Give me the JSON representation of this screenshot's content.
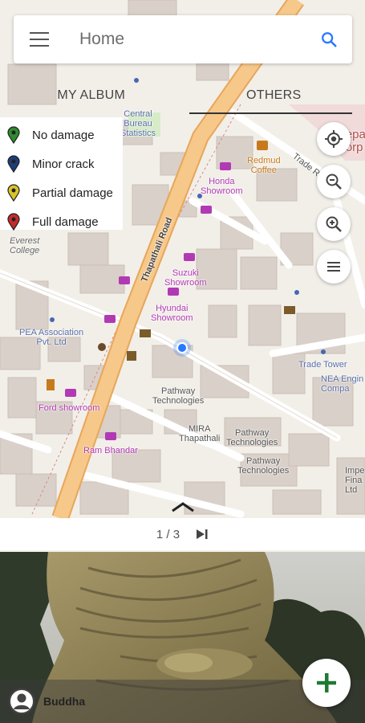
{
  "header": {
    "title": "Home",
    "search_icon": "search-icon",
    "menu_icon": "menu-icon"
  },
  "tabs": [
    {
      "label": "MY ALBUM",
      "active": false
    },
    {
      "label": "OTHERS",
      "active": true
    }
  ],
  "legend": [
    {
      "label": "No damage",
      "color": "#2e8b2e"
    },
    {
      "label": "Minor crack",
      "color": "#1f3c7a"
    },
    {
      "label": "Partial damage",
      "color": "#d8c42a"
    },
    {
      "label": "Full damage",
      "color": "#c62b2b"
    }
  ],
  "map": {
    "labels": {
      "central_bureau": "Central\nBureau\nStatistics",
      "redmud": "Redmud\nCoffee",
      "trade_road": "Trade Road",
      "honda": "Honda\nShowroom",
      "thapathali_road": "Thapathali Road",
      "everest": "Everest\nCollege",
      "suzuki": "Suzuki\nShowroom",
      "hyundai": "Hyundai\nShowroom",
      "pea": "PEA Association\nPvt. Ltd",
      "trade_tower": "Trade Tower",
      "nea": "NEA Engin\nCompa",
      "pathway1": "Pathway\nTechnologies",
      "mira": "MIRA\nThapathali",
      "pathway2": "Pathway\nTechnologies",
      "pathway3": "Pathway\nTechnologies",
      "ford": "Ford showroom",
      "ram": "Ram Bhandar",
      "impe": "Impe\nFina\nLtd",
      "nepa": "Nepa\nCorp"
    },
    "buttons": [
      "my-location-icon",
      "zoom-out-icon",
      "zoom-in-icon",
      "layers-menu-icon"
    ]
  },
  "pager": {
    "text": "1 / 3",
    "next_icon": "skip-to-last-icon"
  },
  "photo": {
    "caption": "Buddha",
    "avatar_icon": "user-avatar-icon"
  },
  "fab": {
    "icon": "add-icon",
    "color": "#1e7a32"
  },
  "colors": {
    "road_major": "#f6c88a",
    "road_major_edge": "#e8a65a",
    "building": "#d9d0c9",
    "map_bg": "#f2efe9",
    "poi": "#b13ab4",
    "accent": "#2979ff"
  }
}
